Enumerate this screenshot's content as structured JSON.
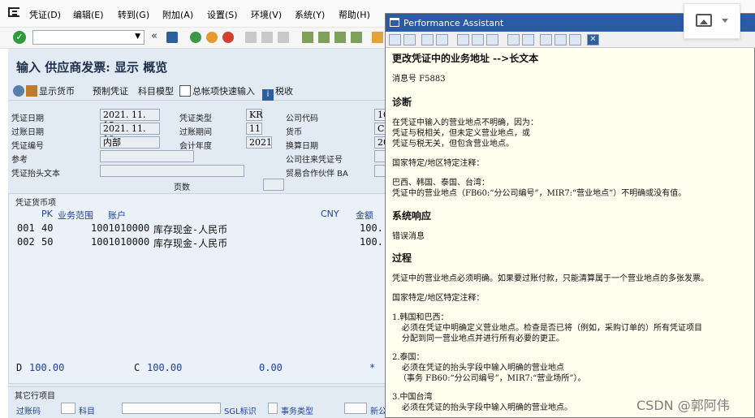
{
  "menu": [
    "凭证(D)",
    "编辑(E)",
    "转到(G)",
    "附加(A)",
    "设置(S)",
    "环境(V)",
    "系统(Y)",
    "帮助(H)"
  ],
  "page_title": "输入 供应商发票: 显示 概览",
  "app_toolbar": {
    "show_currency": "显示货币",
    "park": "预制凭证",
    "account_model": "科目模型",
    "fast_entry": "总帐项快速输入",
    "tax": "税收"
  },
  "header_fields": {
    "doc_date_label": "凭证日期",
    "doc_date": "2021. 11. 15",
    "doc_type_label": "凭证类型",
    "doc_type": "KR",
    "company_code_label": "公司代码",
    "company_code": "10",
    "posting_date_label": "过账日期",
    "posting_date": "2021. 11. 19",
    "period_label": "过账期间",
    "period": "11",
    "currency_label": "货币",
    "currency": "CN",
    "doc_number_label": "凭证编号",
    "doc_number": "内部",
    "fiscal_year_label": "会计年度",
    "fiscal_year": "2021",
    "translation_date_label": "换算日期",
    "translation_date": "20",
    "reference_label": "参考",
    "reference": "",
    "intercompany_label": "公司往来凭证号",
    "intercompany": "",
    "header_text_label": "凭证抬头文本",
    "header_text": "",
    "trading_partner_label": "贸易合作伙伴 BA",
    "trading_partner": "",
    "page_label": "页数",
    "page": ""
  },
  "items": {
    "section_title": "凭证货币项",
    "col_pk": "PK",
    "col_bus_area": "业务范围",
    "col_account": "账户",
    "col_currency": "CNY",
    "col_amount": "金额",
    "rows": [
      {
        "no": "001",
        "pk": "40",
        "account": "1001010000",
        "name": "库存现金-人民币",
        "amount": "100."
      },
      {
        "no": "002",
        "pk": "50",
        "account": "1001010000",
        "name": "库存现金-人民币",
        "amount": "100."
      }
    ],
    "debit_label": "D",
    "debit": "100.00",
    "credit_label": "C",
    "credit": "100.00",
    "balance": "0.00",
    "balance_mark": "*"
  },
  "other_section": {
    "title": "其它行项目",
    "posting_key_label": "过账码",
    "account_label": "科目",
    "sgl_label": "SGL标识",
    "trans_type_label": "事务类型",
    "new_cc_label": "新公"
  },
  "pa": {
    "window_title": "Performance Assistant",
    "heading": "更改凭证中的业务地址 -->长文本",
    "msg_no": "消息号 F5883",
    "diag_title": "诊断",
    "diag_p1": "在凭证中输入的营业地点不明确，因为：",
    "diag_p2": "凭证与税相关，但未定义营业地点，或",
    "diag_p3": "凭证与税无关，但包含营业地点。",
    "diag_p4": "国家特定/地区特定注释：",
    "diag_p5": "巴西、韩国、泰国、台湾：",
    "diag_p6": "凭证中的营业地点（FB60:“分公司编号”，MIR7:“营业地点”）不明确或没有值。",
    "sys_title": "系统响应",
    "sys_p1": "错误消息",
    "proc_title": "过程",
    "proc_p1": "凭证中的营业地点必须明确。如果要过账付款，只能清算属于一个营业地点的多张发票。",
    "proc_p2": "国家特定/地区特定注释：",
    "proc_l1": "1.韩国和巴西：",
    "proc_l1a": "必须在凭证中明确定义营业地点。检查是否已将（例如，采购订单的）所有凭证项目",
    "proc_l1b": "分配到同一营业地点并进行所有必要的更正。",
    "proc_l2": "2.泰国：",
    "proc_l2a": "必须在凭证的抬头字段中输入明确的营业地点",
    "proc_l2b": "（事务 FB60:“分公司编号”，MIR7:“营业场所”）。",
    "proc_l3": "3.中国台湾",
    "proc_l3a": "必须在凭证的抬头字段中输入明确的营业地点。"
  },
  "watermark": "CSDN @郭阿伟",
  "colors": {
    "pa_title": "#2b5aa6",
    "pa_bg": "#fffff0",
    "content_bg": "#e2ebf4",
    "ok_green": "#2f9b3c",
    "item_blue": "#1f3f9b"
  }
}
